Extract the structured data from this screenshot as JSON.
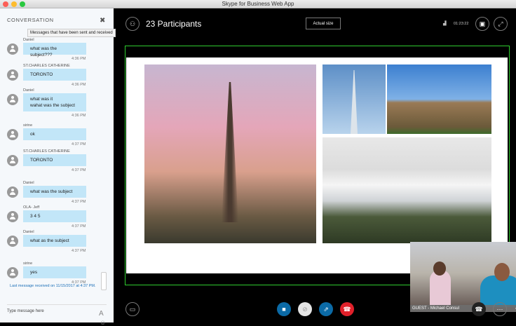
{
  "window": {
    "title": "Skype for Business Web App"
  },
  "conversation": {
    "title": "CONVERSATION",
    "tooltip": "Messages that have been sent and received",
    "messages": [
      {
        "sender": "Daniel",
        "lines": [
          "what was the subject???"
        ],
        "time": "4:36 PM"
      },
      {
        "sender": "ST.CHARLES CATHERINE",
        "lines": [
          "TORONTO"
        ],
        "time": "4:36 PM"
      },
      {
        "sender": "Daniel",
        "lines": [
          "what was it",
          "wahat was the subject"
        ],
        "time": "4:36 PM"
      },
      {
        "sender": "sirine",
        "lines": [
          "ok"
        ],
        "time": "4:37 PM"
      },
      {
        "sender": "ST.CHARLES CATHERINE",
        "lines": [
          "TORONTO"
        ],
        "time": "4:37 PM"
      },
      {
        "sender": "Daniel",
        "lines": [
          "what was the subject"
        ],
        "time": "4:37 PM"
      },
      {
        "sender": "OLA- Jeff",
        "lines": [
          "3 4 5"
        ],
        "time": "4:37 PM"
      },
      {
        "sender": "Daniel",
        "lines": [
          "what as the subject"
        ],
        "time": "4:37 PM"
      },
      {
        "sender": "sirine",
        "lines": [
          "yes"
        ],
        "time": "4:37 PM"
      }
    ],
    "last_message": "Last message received on 11/15/2017 at 4:37 PM.",
    "input_placeholder": "Type message here"
  },
  "meeting": {
    "participants": "23 Participants",
    "actual_size": "Actual size",
    "duration": "01:23:22",
    "video_caption": "GUEST - Michael Consul"
  },
  "colors": {
    "accent_green": "#2ecc2e",
    "video_blue": "#0b6aa6",
    "hangup_red": "#e0202a",
    "bubble": "#c2e6f8"
  }
}
